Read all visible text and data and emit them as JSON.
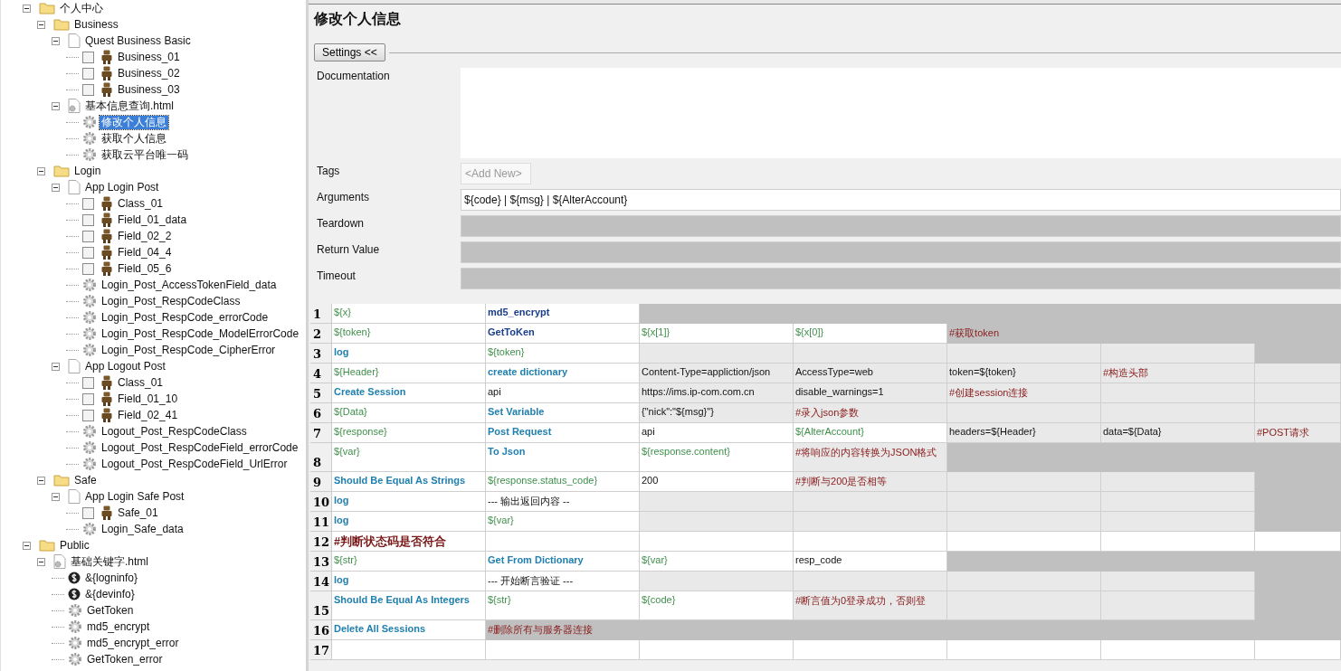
{
  "tree": [
    {
      "label": "个人中心",
      "kind": "folder",
      "expanded": true,
      "selected": false,
      "children": [
        {
          "label": "Business",
          "kind": "folder",
          "expanded": true,
          "selected": false,
          "children": [
            {
              "label": "Quest Business Basic",
              "kind": "suite",
              "expanded": true,
              "selected": false,
              "children": [
                {
                  "label": "Business_01",
                  "kind": "test",
                  "checked": false,
                  "selected": false
                },
                {
                  "label": "Business_02",
                  "kind": "test",
                  "checked": false,
                  "selected": false
                },
                {
                  "label": "Business_03",
                  "kind": "test",
                  "checked": false,
                  "selected": false
                }
              ]
            },
            {
              "label": "基本信息查询.html",
              "kind": "resource",
              "expanded": true,
              "selected": false,
              "children": [
                {
                  "label": "修改个人信息",
                  "kind": "keyword",
                  "selected": true
                },
                {
                  "label": "获取个人信息",
                  "kind": "keyword",
                  "selected": false
                },
                {
                  "label": "获取云平台唯一码",
                  "kind": "keyword",
                  "selected": false
                }
              ]
            }
          ]
        },
        {
          "label": "Login",
          "kind": "folder",
          "expanded": true,
          "selected": false,
          "children": [
            {
              "label": "App Login Post",
              "kind": "suite",
              "expanded": true,
              "selected": false,
              "children": [
                {
                  "label": "Class_01",
                  "kind": "test",
                  "checked": false,
                  "selected": false
                },
                {
                  "label": "Field_01_data",
                  "kind": "test",
                  "checked": false,
                  "selected": false
                },
                {
                  "label": "Field_02_2",
                  "kind": "test",
                  "checked": false,
                  "selected": false
                },
                {
                  "label": "Field_04_4",
                  "kind": "test",
                  "checked": false,
                  "selected": false
                },
                {
                  "label": "Field_05_6",
                  "kind": "test",
                  "checked": false,
                  "selected": false
                },
                {
                  "label": "Login_Post_AccessTokenField_data",
                  "kind": "keyword",
                  "selected": false
                },
                {
                  "label": "Login_Post_RespCodeClass",
                  "kind": "keyword",
                  "selected": false
                },
                {
                  "label": "Login_Post_RespCode_errorCode",
                  "kind": "keyword",
                  "selected": false
                },
                {
                  "label": "Login_Post_RespCode_ModelErrorCode",
                  "kind": "keyword",
                  "selected": false
                },
                {
                  "label": "Login_Post_RespCode_CipherError",
                  "kind": "keyword",
                  "selected": false
                }
              ]
            },
            {
              "label": "App Logout Post",
              "kind": "suite",
              "expanded": true,
              "selected": false,
              "children": [
                {
                  "label": "Class_01",
                  "kind": "test",
                  "checked": false,
                  "selected": false
                },
                {
                  "label": "Field_01_10",
                  "kind": "test",
                  "checked": false,
                  "selected": false
                },
                {
                  "label": "Field_02_41",
                  "kind": "test",
                  "checked": false,
                  "selected": false
                },
                {
                  "label": "Logout_Post_RespCodeClass",
                  "kind": "keyword",
                  "selected": false
                },
                {
                  "label": "Logout_Post_RespCodeField_errorCode",
                  "kind": "keyword",
                  "selected": false
                },
                {
                  "label": "Logout_Post_RespCodeField_UrlError",
                  "kind": "keyword",
                  "selected": false
                }
              ]
            }
          ]
        },
        {
          "label": "Safe",
          "kind": "folder",
          "expanded": true,
          "selected": false,
          "children": [
            {
              "label": "App Login Safe Post",
              "kind": "suite",
              "expanded": true,
              "selected": false,
              "children": [
                {
                  "label": "Safe_01",
                  "kind": "test",
                  "checked": false,
                  "selected": false
                },
                {
                  "label": "Login_Safe_data",
                  "kind": "keyword",
                  "selected": false
                }
              ]
            }
          ]
        }
      ]
    },
    {
      "label": "Public",
      "kind": "folder",
      "expanded": true,
      "selected": false,
      "children": [
        {
          "label": "基础关键字.html",
          "kind": "resource",
          "expanded": true,
          "selected": false,
          "children": [
            {
              "label": "&{logninfo}",
              "kind": "variable",
              "selected": false
            },
            {
              "label": "&{devinfo}",
              "kind": "variable",
              "selected": false
            },
            {
              "label": "GetToken",
              "kind": "keyword",
              "selected": false
            },
            {
              "label": "md5_encrypt",
              "kind": "keyword",
              "selected": false
            },
            {
              "label": "md5_encrypt_error",
              "kind": "keyword",
              "selected": false
            },
            {
              "label": "GetToken_error",
              "kind": "keyword",
              "selected": false
            }
          ]
        }
      ]
    }
  ],
  "editor": {
    "title": "修改个人信息",
    "settings_button": "Settings <<",
    "fields": [
      {
        "label": "Documentation",
        "kind": "text-area"
      },
      {
        "label": "Tags",
        "kind": "tags",
        "placeholder": "<Add New>"
      },
      {
        "label": "Arguments",
        "kind": "line",
        "value": "${code} | ${msg} | ${AlterAccount}",
        "disabled": false
      },
      {
        "label": "Teardown",
        "kind": "line",
        "disabled": true
      },
      {
        "label": "Return Value",
        "kind": "line",
        "disabled": true
      },
      {
        "label": "Timeout",
        "kind": "line",
        "disabled": true
      }
    ]
  },
  "grid": {
    "rows": [
      {
        "number": "1",
        "tall": false,
        "cells": [
          {
            "text": "${x}",
            "kind": "variable",
            "unused": false,
            "optional": false
          },
          {
            "text": "md5_encrypt",
            "kind": "user-keyword",
            "unused": false,
            "optional": false
          },
          {
            "unused": true,
            "optional": false
          },
          {
            "unused": true,
            "optional": false
          },
          {
            "unused": true,
            "optional": false
          },
          {
            "unused": true,
            "optional": false
          },
          {
            "unused": true,
            "optional": false
          }
        ]
      },
      {
        "number": "2",
        "tall": false,
        "cells": [
          {
            "text": "${token}",
            "kind": "variable",
            "unused": false,
            "optional": false
          },
          {
            "text": "GetToKen",
            "kind": "user-keyword",
            "unused": false,
            "optional": false
          },
          {
            "text": "${x[1]}",
            "kind": "variable",
            "unused": false,
            "optional": false
          },
          {
            "text": "${x[0]}",
            "kind": "variable",
            "unused": false,
            "optional": false
          },
          {
            "text": "#获取token",
            "kind": "comment",
            "unused": true,
            "optional": false
          },
          {
            "unused": true,
            "optional": false
          },
          {
            "unused": true,
            "optional": false
          }
        ]
      },
      {
        "number": "3",
        "tall": false,
        "cells": [
          {
            "text": "log",
            "kind": "keyword",
            "unused": false,
            "optional": false
          },
          {
            "text": "${token}",
            "kind": "variable",
            "unused": false,
            "optional": false
          },
          {
            "unused": false,
            "optional": true
          },
          {
            "unused": false,
            "optional": true
          },
          {
            "unused": false,
            "optional": true
          },
          {
            "unused": false,
            "optional": true
          },
          {
            "unused": true,
            "optional": false
          }
        ]
      },
      {
        "number": "4",
        "tall": false,
        "cells": [
          {
            "text": "${Header}",
            "kind": "variable",
            "unused": false,
            "optional": false
          },
          {
            "text": "create dictionary",
            "kind": "keyword",
            "unused": false,
            "optional": false
          },
          {
            "text": "Content-Type=appliction/json",
            "kind": "text",
            "unused": false,
            "optional": true
          },
          {
            "text": "AccessType=web",
            "kind": "text",
            "unused": false,
            "optional": true
          },
          {
            "text": "token=${token}",
            "kind": "text",
            "unused": false,
            "optional": true
          },
          {
            "text": "#构造头部",
            "kind": "comment",
            "unused": false,
            "optional": true
          },
          {
            "unused": false,
            "optional": true
          }
        ]
      },
      {
        "number": "5",
        "tall": false,
        "cells": [
          {
            "text": "Create Session",
            "kind": "keyword",
            "unused": false,
            "optional": false
          },
          {
            "text": "api",
            "kind": "text",
            "unused": false,
            "optional": false
          },
          {
            "text": "https://ims.ip-com.com.cn",
            "kind": "text",
            "unused": false,
            "optional": true
          },
          {
            "text": "disable_warnings=1",
            "kind": "text",
            "unused": false,
            "optional": true
          },
          {
            "text": "#创建session连接",
            "kind": "comment",
            "unused": false,
            "optional": true
          },
          {
            "unused": false,
            "optional": true
          },
          {
            "unused": false,
            "optional": true
          }
        ]
      },
      {
        "number": "6",
        "tall": false,
        "cells": [
          {
            "text": "${Data}",
            "kind": "variable",
            "unused": false,
            "optional": false
          },
          {
            "text": "Set Variable",
            "kind": "keyword",
            "unused": false,
            "optional": false
          },
          {
            "text": "{\"nick\":\"${msg}\"}",
            "kind": "text",
            "unused": false,
            "optional": true
          },
          {
            "text": "#录入json参数",
            "kind": "comment",
            "unused": false,
            "optional": true
          },
          {
            "unused": false,
            "optional": true
          },
          {
            "unused": false,
            "optional": true
          },
          {
            "unused": false,
            "optional": true
          }
        ]
      },
      {
        "number": "7",
        "tall": false,
        "cells": [
          {
            "text": "${response}",
            "kind": "variable",
            "unused": false,
            "optional": false
          },
          {
            "text": "Post Request",
            "kind": "keyword",
            "unused": false,
            "optional": false
          },
          {
            "text": "api",
            "kind": "text",
            "unused": false,
            "optional": false
          },
          {
            "text": "${AlterAccount}",
            "kind": "variable",
            "unused": false,
            "optional": false
          },
          {
            "text": "headers=${Header}",
            "kind": "text",
            "unused": false,
            "optional": true
          },
          {
            "text": "data=${Data}",
            "kind": "text",
            "unused": false,
            "optional": true
          },
          {
            "text": "#POST请求",
            "kind": "comment",
            "unused": false,
            "optional": true
          }
        ]
      },
      {
        "number": "8",
        "tall": true,
        "cells": [
          {
            "text": "${var}",
            "kind": "variable",
            "unused": false,
            "optional": false
          },
          {
            "text": "To Json",
            "kind": "keyword",
            "unused": false,
            "optional": false
          },
          {
            "text": "${response.content}",
            "kind": "variable",
            "unused": false,
            "optional": false
          },
          {
            "text": "#将响应的内容转换为JSON格式",
            "kind": "comment",
            "unused": false,
            "optional": true
          },
          {
            "unused": true,
            "optional": false
          },
          {
            "unused": true,
            "optional": false
          },
          {
            "unused": true,
            "optional": false
          }
        ]
      },
      {
        "number": "9",
        "tall": false,
        "cells": [
          {
            "text": "Should Be Equal As Strings",
            "kind": "keyword",
            "unused": false,
            "optional": false
          },
          {
            "text": "${response.status_code}",
            "kind": "variable",
            "unused": false,
            "optional": false
          },
          {
            "text": "200",
            "kind": "text",
            "unused": false,
            "optional": false
          },
          {
            "text": "#判断与200是否相等",
            "kind": "comment",
            "unused": false,
            "optional": true
          },
          {
            "unused": false,
            "optional": true
          },
          {
            "unused": false,
            "optional": true
          },
          {
            "unused": true,
            "optional": false
          }
        ]
      },
      {
        "number": "10",
        "tall": false,
        "cells": [
          {
            "text": "log",
            "kind": "keyword",
            "unused": false,
            "optional": false
          },
          {
            "text": "--- 输出返回内容 --",
            "kind": "text",
            "unused": false,
            "optional": false
          },
          {
            "unused": false,
            "optional": true
          },
          {
            "unused": false,
            "optional": true
          },
          {
            "unused": false,
            "optional": true
          },
          {
            "unused": false,
            "optional": true
          },
          {
            "unused": true,
            "optional": false
          }
        ]
      },
      {
        "number": "11",
        "tall": false,
        "cells": [
          {
            "text": "log",
            "kind": "keyword",
            "unused": false,
            "optional": false
          },
          {
            "text": "${var}",
            "kind": "variable",
            "unused": false,
            "optional": false
          },
          {
            "unused": false,
            "optional": true
          },
          {
            "unused": false,
            "optional": true
          },
          {
            "unused": false,
            "optional": true
          },
          {
            "unused": false,
            "optional": true
          },
          {
            "unused": true,
            "optional": false
          }
        ]
      },
      {
        "number": "12",
        "tall": false,
        "cells": [
          {
            "text": "#判断状态码是否符合",
            "kind": "section",
            "unused": false,
            "optional": false
          },
          {
            "unused": false,
            "optional": false
          },
          {
            "unused": false,
            "optional": false
          },
          {
            "unused": false,
            "optional": false
          },
          {
            "unused": false,
            "optional": false
          },
          {
            "unused": false,
            "optional": false
          },
          {
            "unused": false,
            "optional": false
          }
        ]
      },
      {
        "number": "13",
        "tall": false,
        "cells": [
          {
            "text": "${str}",
            "kind": "variable",
            "unused": false,
            "optional": false
          },
          {
            "text": "Get From Dictionary",
            "kind": "keyword",
            "unused": false,
            "optional": false
          },
          {
            "text": "${var}",
            "kind": "variable",
            "unused": false,
            "optional": false
          },
          {
            "text": "resp_code",
            "kind": "text",
            "unused": false,
            "optional": false
          },
          {
            "unused": true,
            "optional": false
          },
          {
            "unused": true,
            "optional": false
          },
          {
            "unused": true,
            "optional": false
          }
        ]
      },
      {
        "number": "14",
        "tall": false,
        "cells": [
          {
            "text": "log",
            "kind": "keyword",
            "unused": false,
            "optional": false
          },
          {
            "text": "--- 开始断言验证 ---",
            "kind": "text",
            "unused": false,
            "optional": false
          },
          {
            "unused": false,
            "optional": true
          },
          {
            "unused": false,
            "optional": true
          },
          {
            "unused": false,
            "optional": true
          },
          {
            "unused": false,
            "optional": true
          },
          {
            "unused": true,
            "optional": false
          }
        ]
      },
      {
        "number": "15",
        "tall": true,
        "cells": [
          {
            "text": "Should Be Equal As Integers",
            "kind": "keyword",
            "unused": false,
            "optional": false
          },
          {
            "text": "${str}",
            "kind": "variable",
            "unused": false,
            "optional": false
          },
          {
            "text": "${code}",
            "kind": "variable",
            "unused": false,
            "optional": false
          },
          {
            "text": "#断言值为0登录成功，否则登",
            "kind": "comment",
            "unused": false,
            "optional": true
          },
          {
            "unused": false,
            "optional": true
          },
          {
            "unused": false,
            "optional": true
          },
          {
            "unused": true,
            "optional": false
          }
        ]
      },
      {
        "number": "16",
        "tall": false,
        "cells": [
          {
            "text": "Delete All Sessions",
            "kind": "keyword",
            "unused": false,
            "optional": false
          },
          {
            "text": "#删除所有与服务器连接",
            "kind": "comment",
            "unused": true,
            "optional": false
          },
          {
            "unused": true,
            "optional": false
          },
          {
            "unused": true,
            "optional": false
          },
          {
            "unused": true,
            "optional": false
          },
          {
            "unused": true,
            "optional": false
          },
          {
            "unused": true,
            "optional": false
          }
        ]
      },
      {
        "number": "17",
        "tall": false,
        "cells": [
          {
            "unused": false,
            "optional": false
          },
          {
            "unused": false,
            "optional": false
          },
          {
            "unused": false,
            "optional": false
          },
          {
            "unused": false,
            "optional": false
          },
          {
            "unused": false,
            "optional": false
          },
          {
            "unused": false,
            "optional": false
          },
          {
            "unused": false,
            "optional": false
          }
        ]
      }
    ]
  }
}
